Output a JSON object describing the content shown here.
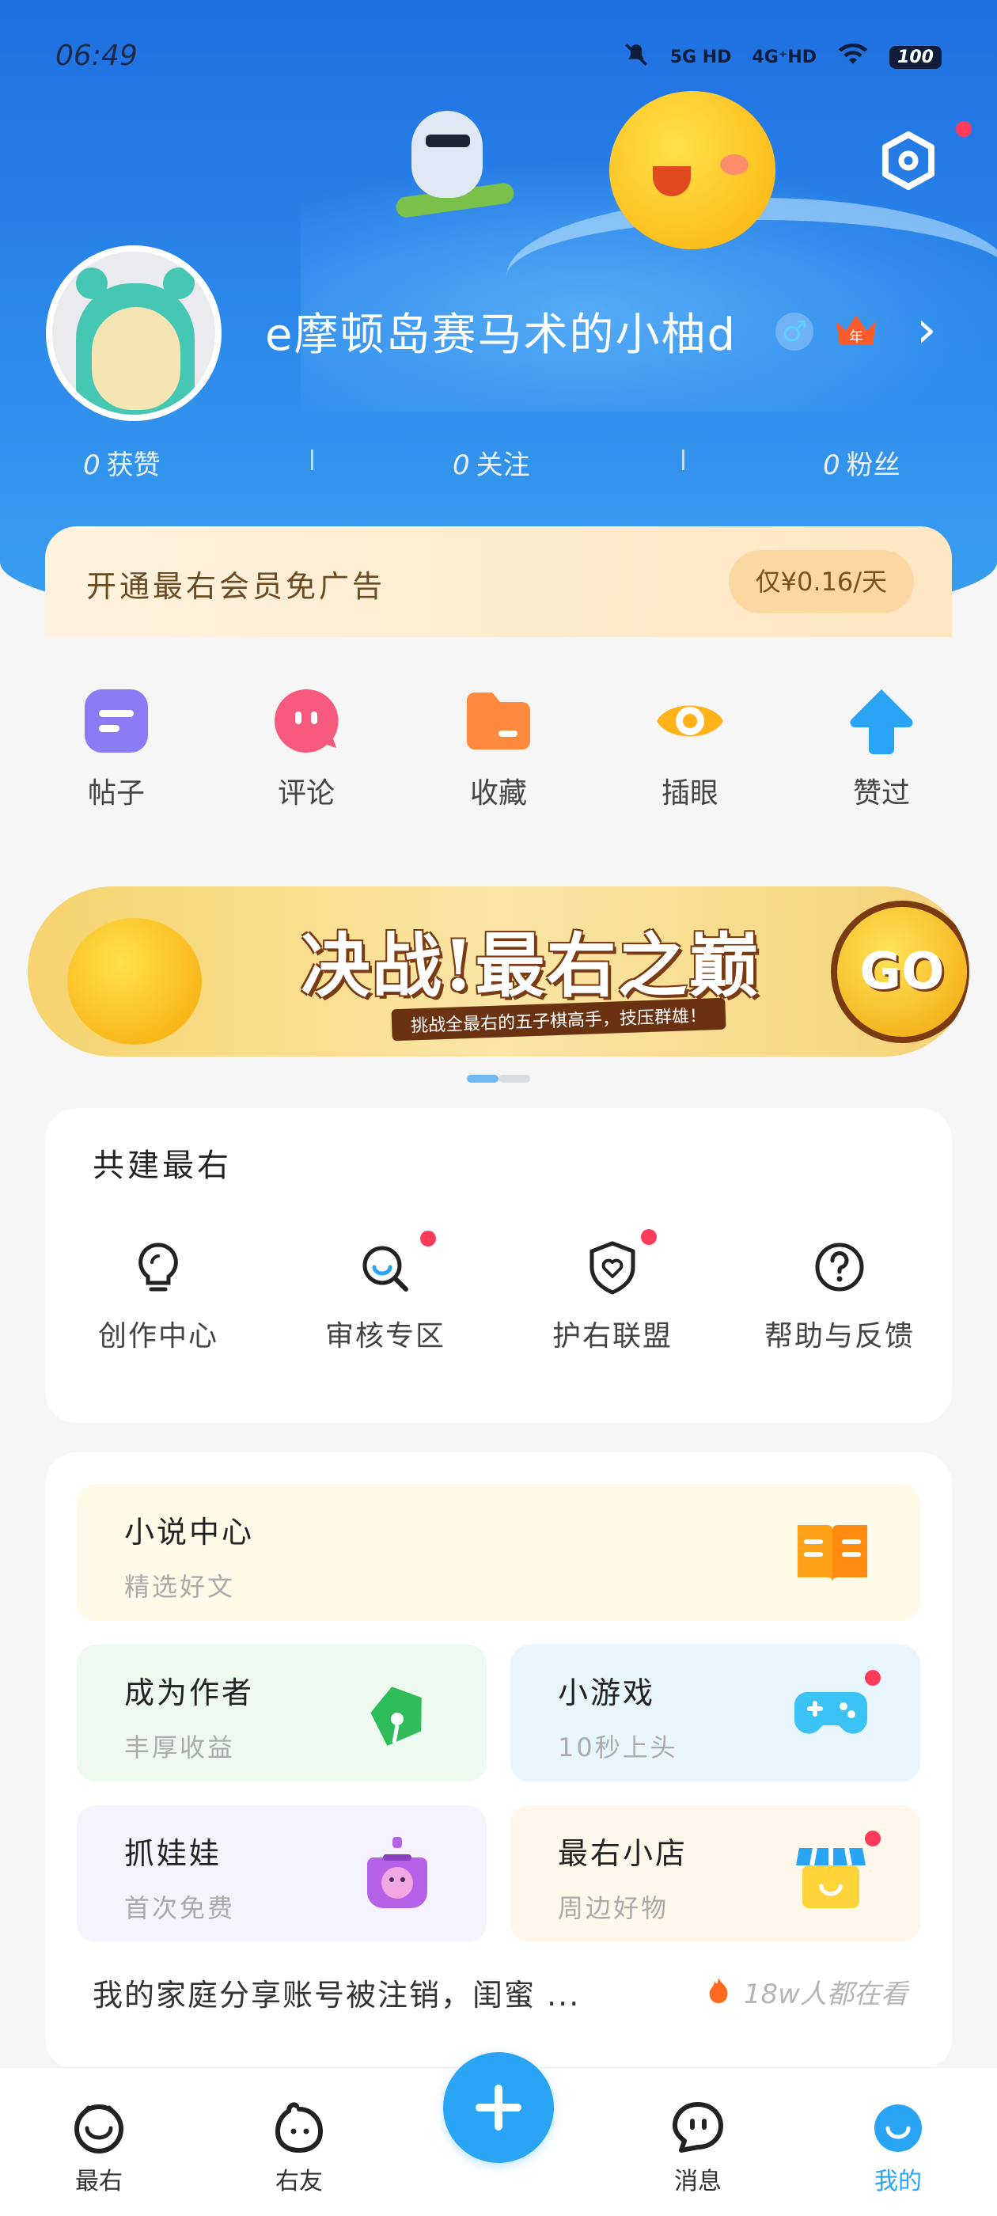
{
  "status_bar": {
    "time": "06:49",
    "sim1": "5G HD",
    "sim2": "4G⁺HD",
    "battery": "100"
  },
  "profile": {
    "username": "e摩顿岛赛马术的小柚d",
    "gender_icon": "male-icon",
    "vip_badge": "年",
    "stats": [
      {
        "value": "0",
        "label": "获赞"
      },
      {
        "value": "0",
        "label": "关注"
      },
      {
        "value": "0",
        "label": "粉丝"
      }
    ]
  },
  "vip_banner": {
    "text": "开通最右会员免广告",
    "price": "仅¥0.16/天"
  },
  "quick_actions": [
    {
      "label": "帖子",
      "icon": "post-icon",
      "color": "#8b7bf5"
    },
    {
      "label": "评论",
      "icon": "comment-icon",
      "color": "#f75a7c"
    },
    {
      "label": "收藏",
      "icon": "folder-icon",
      "color": "#ff8a3d"
    },
    {
      "label": "插眼",
      "icon": "eye-icon",
      "color": "#ffb21a"
    },
    {
      "label": "赞过",
      "icon": "thumb-up-icon",
      "color": "#2aa4f4"
    }
  ],
  "game_banner": {
    "title": "决战!最右之巅",
    "subtitle": "挑战全最右的五子棋高手，技压群雄！",
    "go": "GO"
  },
  "co_build": {
    "title": "共建最右",
    "items": [
      {
        "label": "创作中心",
        "icon": "lightbulb-icon",
        "dot": false
      },
      {
        "label": "审核专区",
        "icon": "review-search-icon",
        "dot": true
      },
      {
        "label": "护右联盟",
        "icon": "shield-heart-icon",
        "dot": true
      },
      {
        "label": "帮助与反馈",
        "icon": "help-icon",
        "dot": false
      }
    ]
  },
  "features": {
    "novel": {
      "title": "小说中心",
      "sub": "精选好文"
    },
    "author": {
      "title": "成为作者",
      "sub": "丰厚收益"
    },
    "games": {
      "title": "小游戏",
      "sub": "10秒上头"
    },
    "claw": {
      "title": "抓娃娃",
      "sub": "首次免费"
    },
    "shop": {
      "title": "最右小店",
      "sub": "周边好物"
    }
  },
  "hot_topic": {
    "title": "我的家庭分享账号被注销，闺蜜 ...",
    "meta": "18w人都在看"
  },
  "bottom_nav": [
    {
      "label": "最右",
      "icon": "home-face-icon"
    },
    {
      "label": "右友",
      "icon": "friends-icon"
    },
    {
      "label": "消息",
      "icon": "message-icon"
    },
    {
      "label": "我的",
      "icon": "me-icon"
    }
  ],
  "colors": {
    "accent": "#2aa4f4",
    "header_top": "#1f6fe0",
    "badge_red": "#ff3b5c"
  }
}
